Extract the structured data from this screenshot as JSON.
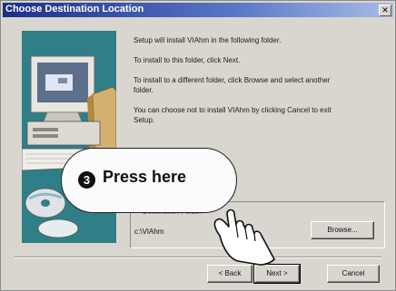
{
  "window": {
    "title": "Choose Destination Location",
    "close_glyph": "✕"
  },
  "body": {
    "line1": "Setup will install VIAhm in the following folder.",
    "line2": "To install to this folder, click Next.",
    "line3a": "To install to a different folder, click Browse and select another",
    "line3b": "folder.",
    "line4a": "You can choose not to install VIAhm by clicking Cancel to exit",
    "line4b": "Setup."
  },
  "destination": {
    "group_label": "Destination Folder",
    "path": "c:\\VIAhm",
    "browse_label": "Browse..."
  },
  "buttons": {
    "back": "< Back",
    "next": "Next >",
    "cancel": "Cancel"
  },
  "callout": {
    "step_number": "3",
    "text": "Press here"
  },
  "colors": {
    "title_bar": "#1c2f86",
    "dialog_face": "#d8d6cf",
    "art_background": "#2f7f88"
  },
  "icons": [
    "computer-illustration",
    "pointing-hand-icon",
    "close-icon"
  ]
}
